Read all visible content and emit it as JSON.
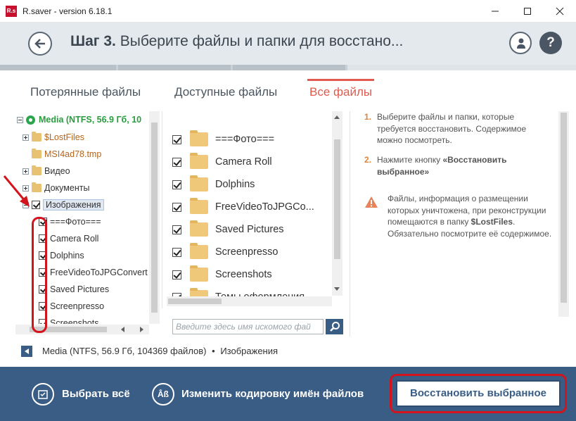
{
  "window": {
    "logo_text": "R.s",
    "title": "R.saver - version 6.18.1"
  },
  "header": {
    "step_label": "Шаг 3.",
    "step_text": "Выберите файлы и папки для восстано..."
  },
  "tabs": [
    {
      "label": "Потерянные файлы",
      "active": false
    },
    {
      "label": "Доступные файлы",
      "active": false
    },
    {
      "label": "Все файлы",
      "active": true
    }
  ],
  "tree": {
    "root": "Media (NTFS, 56.9 Гб, 10",
    "items": [
      {
        "label": "$LostFiles"
      },
      {
        "label": "MSI4ad78.tmp"
      },
      {
        "label": "Видео"
      },
      {
        "label": "Документы"
      },
      {
        "label": "Изображения"
      },
      {
        "label": "===Фото==="
      },
      {
        "label": "Camera Roll"
      },
      {
        "label": "Dolphins"
      },
      {
        "label": "FreeVideoToJPGConvert"
      },
      {
        "label": "Saved Pictures"
      },
      {
        "label": "Screenpresso"
      },
      {
        "label": "Screenshots"
      }
    ]
  },
  "files": [
    {
      "name": "===Фото===",
      "checked": true
    },
    {
      "name": "Camera Roll",
      "checked": true
    },
    {
      "name": "Dolphins",
      "checked": true
    },
    {
      "name": "FreeVideoToJPGCo...",
      "checked": true
    },
    {
      "name": "Saved Pictures",
      "checked": true
    },
    {
      "name": "Screenpresso",
      "checked": true
    },
    {
      "name": "Screenshots",
      "checked": true
    },
    {
      "name": "Темы оформления",
      "checked": true
    }
  ],
  "search": {
    "placeholder": "Введите здесь имя искомого фай"
  },
  "info": {
    "step1_num": "1.",
    "step1_text": "Выберите файлы и папки, которые требуется восстановить. Содержимое можно посмотреть.",
    "step2_num": "2.",
    "step2_prefix": "Нажмите кнопку ",
    "step2_bold": "«Восстановить выбранное»",
    "warn_prefix": "Файлы, информация о размещении которых уничтожена, при реконструкции помещаются в папку ",
    "warn_bold": "$LostFiles",
    "warn_suffix": ". Обязательно посмотрите её содержимое."
  },
  "path": {
    "drive": "Media (NTFS, 56.9 Гб, 104369 файлов)",
    "separator": "•",
    "folder": "Изображения"
  },
  "bottom": {
    "select_all": "Выбрать всё",
    "encoding": "Изменить кодировку имён файлов",
    "encoding_icon_text": "Âß",
    "restore": "Восстановить выбранное"
  },
  "colors": {
    "accent_blue": "#3a5d85",
    "tab_active": "#e05a4f",
    "annotation_red": "#d4141c",
    "header_bg": "#e4e9ee"
  }
}
